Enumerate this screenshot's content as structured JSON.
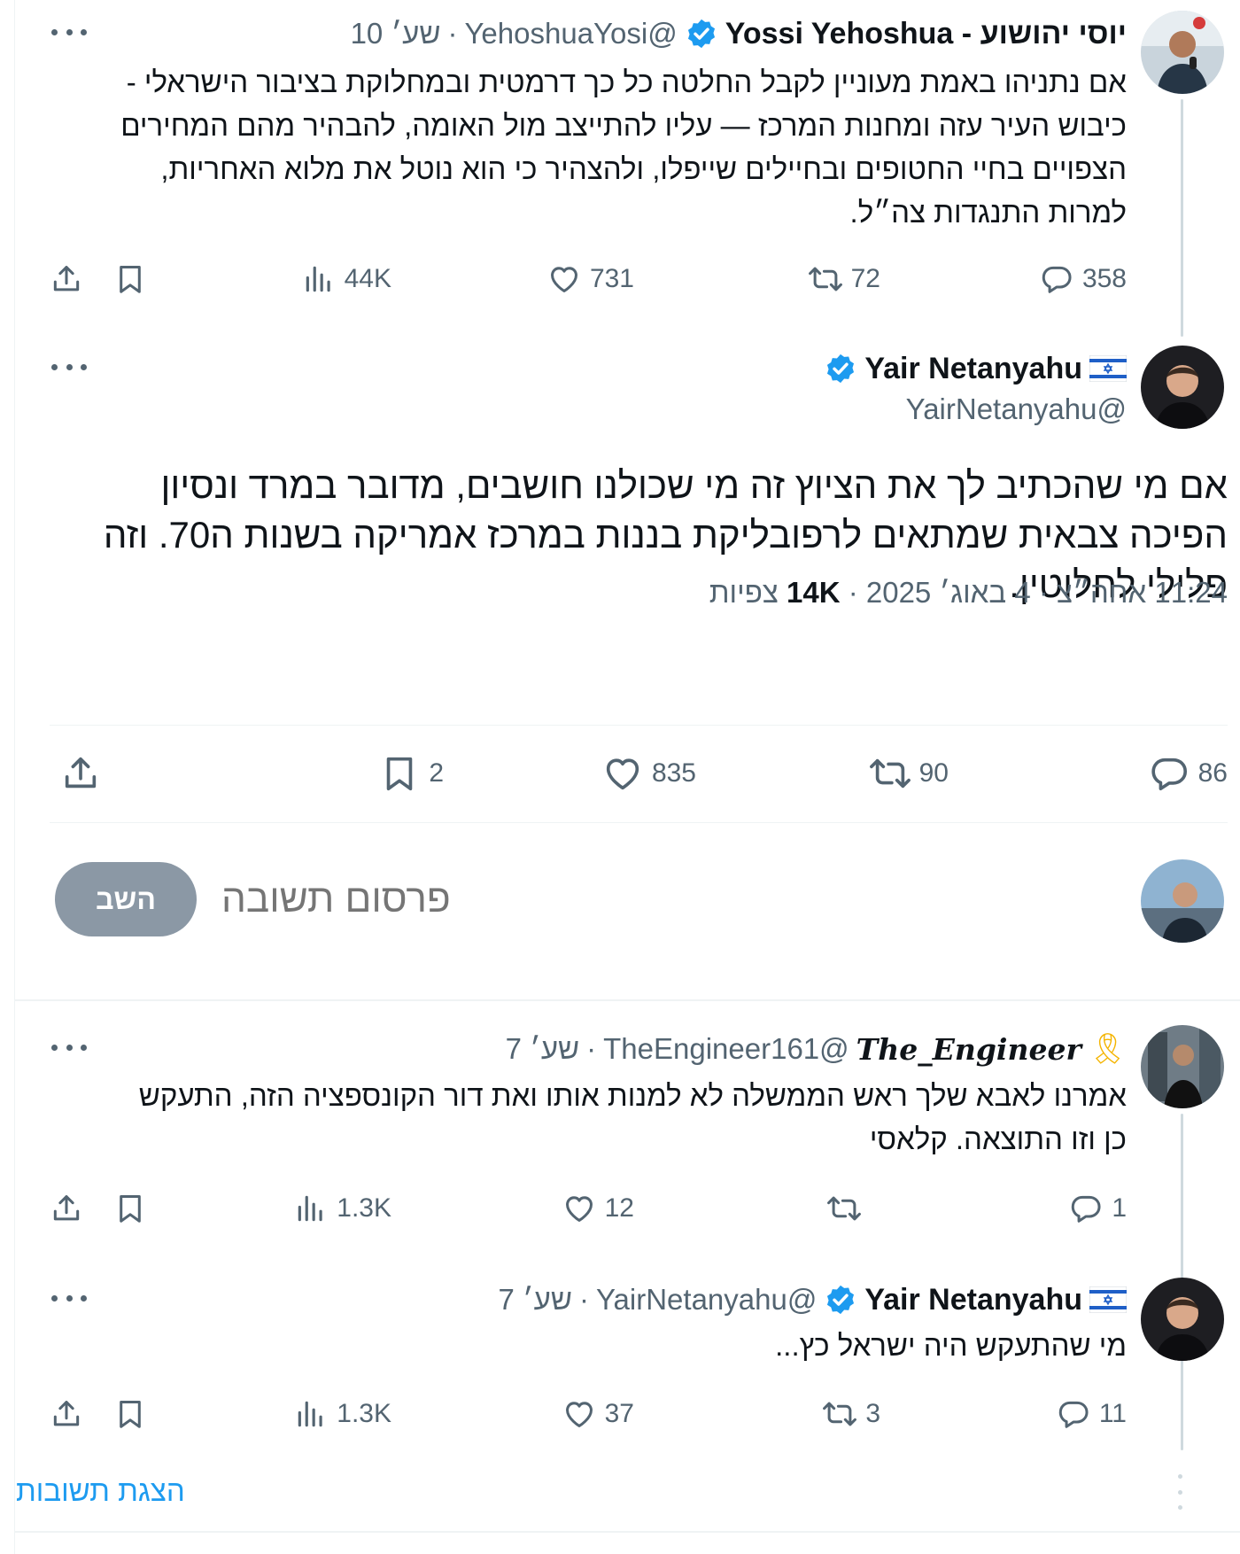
{
  "tweets": {
    "parent": {
      "name": "Yossi Yehoshua - יוסי יהושוע",
      "handle": "@YehoshuaYosi",
      "separator": "·",
      "time": "שע׳ 10",
      "text": "אם נתניהו באמת מעוניין לקבל החלטה כל כך דרמטית ובמחלוקת  בציבור הישראלי - כיבוש העיר עזה ומחנות המרכז — עליו להתייצב מול האומה, להבהיר מהם המחירים הצפויים בחיי החטופים ובחיילים שייפלו, ולהצהיר כי הוא נוטל את מלוא האחריות, למרות התנגדות צה״ל.",
      "stats": {
        "replies": "358",
        "reposts": "72",
        "likes": "731",
        "views": "44K"
      }
    },
    "main": {
      "name": "Yair Netanyahu",
      "handle": "@YairNetanyahu",
      "text": "אם מי שהכתיב לך את הציוץ זה מי שכולנו חושבים, מדובר במרד ונסיון הפיכה צבאית שמתאים לרפובליקת בננות במרכז אמריקה בשנות ה70. וזה פלילי לחלוטין.",
      "meta_date": "11:24 אחה״צ · 4 באוג׳ 2025 · ",
      "meta_views_count": "14K",
      "meta_views_label": "צפיות",
      "stats": {
        "replies": "86",
        "reposts": "90",
        "likes": "835",
        "bookmarks": "2"
      }
    },
    "composer": {
      "placeholder": "פרסום תשובה",
      "button": "השב"
    },
    "reply1": {
      "name": "The_Engineer",
      "handle": "@TheEngineer161",
      "separator": "·",
      "time": "שע׳ 7",
      "text": "אמרנו לאבא שלך ראש הממשלה לא למנות אותו ואת דור הקונספציה הזה, התעקש כן וזו התוצאה. קלאסי",
      "stats": {
        "replies": "1",
        "reposts": "",
        "likes": "12",
        "views": "1.3K"
      }
    },
    "reply2": {
      "name": "Yair Netanyahu",
      "handle": "@YairNetanyahu",
      "separator": "·",
      "time": "שע׳ 7",
      "text": "מי שהתעקש היה ישראל כץ...",
      "stats": {
        "replies": "11",
        "reposts": "3",
        "likes": "37",
        "views": "1.3K"
      }
    },
    "show_replies": "הצגת תשובות"
  },
  "colors": {
    "text_primary": "#0f1419",
    "text_secondary": "#536471",
    "verified": "#1d9bf0",
    "link": "#1d9bf0",
    "thread_line": "#cfd9de",
    "reply_button": "#8b98a5",
    "ribbon": "#f4b400"
  },
  "icons": [
    "more-icon",
    "verified-badge-icon",
    "israel-flag-icon",
    "yellow-ribbon-icon",
    "reply-icon",
    "repost-icon",
    "like-icon",
    "views-icon",
    "bookmark-icon",
    "share-icon"
  ]
}
